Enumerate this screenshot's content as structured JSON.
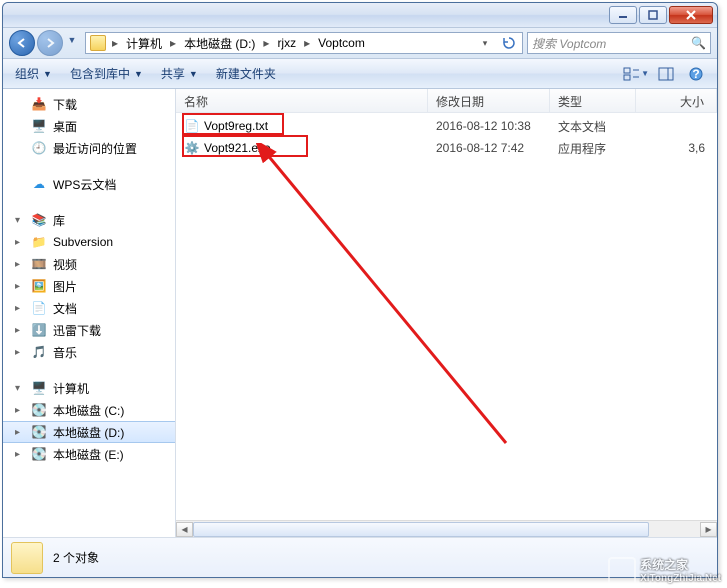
{
  "titlebar": {},
  "breadcrumb": {
    "seg1": "计算机",
    "seg2": "本地磁盘 (D:)",
    "seg3": "rjxz",
    "seg4": "Voptcom"
  },
  "search": {
    "placeholder": "搜索 Voptcom"
  },
  "toolbar": {
    "organize": "组织",
    "include": "包含到库中",
    "share": "共享",
    "newfolder": "新建文件夹"
  },
  "sidebar": {
    "fav": {
      "downloads": "下载",
      "desktop": "桌面",
      "recent": "最近访问的位置"
    },
    "wps": "WPS云文档",
    "library": {
      "label": "库",
      "subversion": "Subversion",
      "videos": "视频",
      "pictures": "图片",
      "documents": "文档",
      "xunlei": "迅雷下载",
      "music": "音乐"
    },
    "computer": {
      "label": "计算机",
      "c": "本地磁盘 (C:)",
      "d": "本地磁盘 (D:)",
      "e": "本地磁盘 (E:)"
    }
  },
  "columns": {
    "name": "名称",
    "date": "修改日期",
    "type": "类型",
    "size": "大小"
  },
  "files": [
    {
      "name": "Vopt9reg.txt",
      "date": "2016-08-12 10:38",
      "type": "文本文档",
      "size": ""
    },
    {
      "name": "Vopt921.exe",
      "date": "2016-08-12 7:42",
      "type": "应用程序",
      "size": "3,6"
    }
  ],
  "status": {
    "count": "2 个对象"
  },
  "watermark": {
    "name": "系统之家",
    "url": "XiTongZhiJia.Net"
  }
}
